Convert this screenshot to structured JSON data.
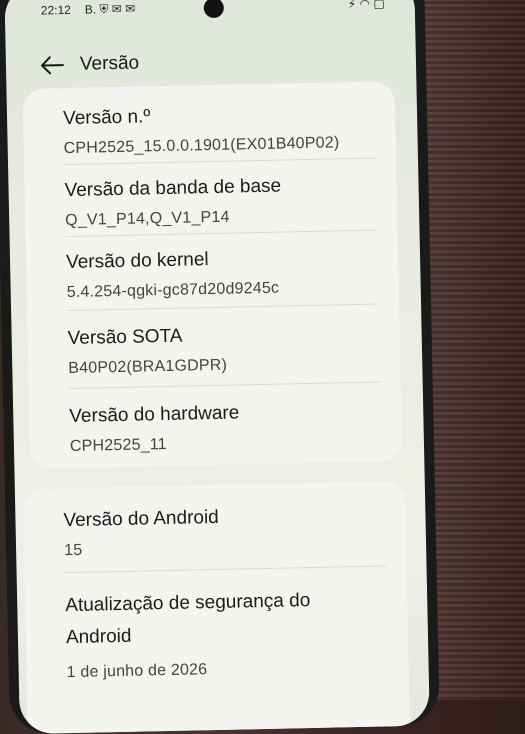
{
  "status_bar": {
    "time": "22:12",
    "notifications": "B. ⛨ ✉ ✉",
    "system": "⚡ ◠ ▢"
  },
  "header": {
    "back_icon": "arrow-left-icon",
    "title": "Versão"
  },
  "info_card": {
    "items": [
      {
        "label": "Versão n.º",
        "value": "CPH2525_15.0.0.1901(EX01B40P02)"
      },
      {
        "label": "Versão da banda de base",
        "value": "Q_V1_P14,Q_V1_P14"
      },
      {
        "label": "Versão do kernel",
        "value": "5.4.254-qgki-gc87d20d9245c"
      },
      {
        "label": "Versão SOTA",
        "value": "B40P02(BRA1GDPR)"
      },
      {
        "label": "Versão do hardware",
        "value": "CPH2525_11"
      }
    ]
  },
  "android_card": {
    "items": [
      {
        "label": "Versão do Android",
        "value": "15"
      },
      {
        "label": "Atualização de segurança do Android",
        "value": "1 de junho de 2026"
      }
    ]
  }
}
